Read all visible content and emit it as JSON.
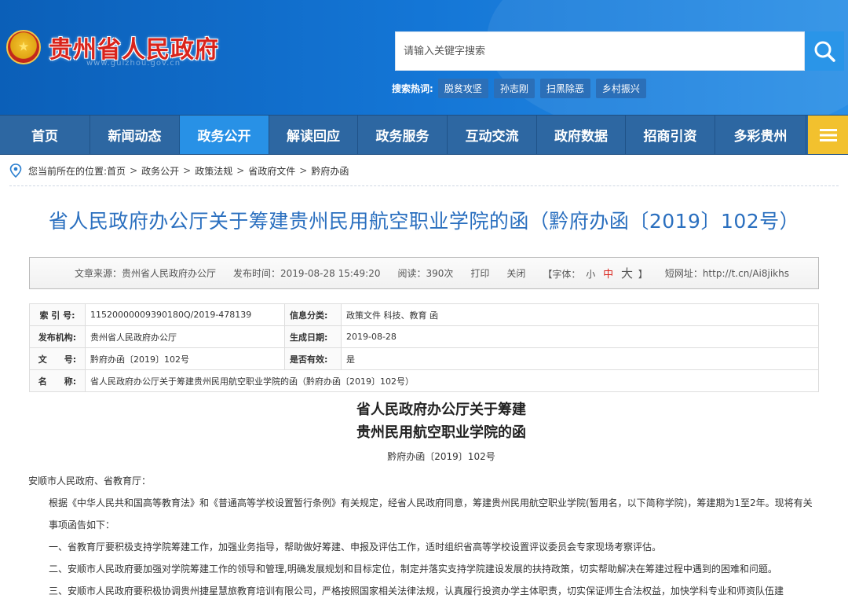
{
  "header": {
    "title": "贵州省人民政府",
    "subtitle": "www.guizhou.gov.cn",
    "search_placeholder": "请输入关键字搜索",
    "hot_label": "搜索热词:",
    "hot_tags": [
      "脱贫攻坚",
      "孙志刚",
      "扫黑除恶",
      "乡村振兴"
    ]
  },
  "nav": {
    "items": [
      "首页",
      "新闻动态",
      "政务公开",
      "解读回应",
      "政务服务",
      "互动交流",
      "政府数据",
      "招商引资",
      "多彩贵州"
    ],
    "active_index": 2
  },
  "breadcrumb": {
    "prefix": "您当前所在的位置:",
    "items": [
      "首页",
      "政务公开",
      "政策法规",
      "省政府文件",
      "黔府办函"
    ],
    "sep": ">"
  },
  "doc_title": "省人民政府办公厅关于筹建贵州民用航空职业学院的函（黔府办函〔2019〕102号）",
  "meta": {
    "source": "文章来源：贵州省人民政府办公厅",
    "time": "发布时间：2019-08-28 15:49:20",
    "views": "阅读：390次",
    "print": "打印",
    "close": "关闭",
    "font_label": "【字体：",
    "font_small": "小",
    "font_mid": "中",
    "font_big": "大",
    "font_end": "】",
    "short_url": "短网址：http://t.cn/Ai8jikhs"
  },
  "info": {
    "index_label": "索 引 号:",
    "index_value": "11520000009390180Q/2019-478139",
    "category_label": "信息分类:",
    "category_value": "政策文件   科技、教育   函",
    "org_label": "发布机构:",
    "org_value": "贵州省人民政府办公厅",
    "date_label": "生成日期:",
    "date_value": "2019-08-28",
    "docno_label": "文　　号:",
    "docno_value": "黔府办函〔2019〕102号",
    "valid_label": "是否有效:",
    "valid_value": "是",
    "name_label": "名　　称:",
    "name_value": "省人民政府办公厅关于筹建贵州民用航空职业学院的函（黔府办函〔2019〕102号）"
  },
  "article": {
    "title_line1": "省人民政府办公厅关于筹建",
    "title_line2": "贵州民用航空职业学院的函",
    "doc_no": "黔府办函〔2019〕102号",
    "salutation": "安顺市人民政府、省教育厅：",
    "para1": "根据《中华人民共和国高等教育法》和《普通高等学校设置暂行条例》有关规定，经省人民政府同意，筹建贵州民用航空职业学院(暂用名，以下简称学院)，筹建期为1至2年。现将有关事项函告如下：",
    "item1": "一、省教育厅要积极支持学院筹建工作，加强业务指导，帮助做好筹建、申报及评估工作，适时组织省高等学校设置评议委员会专家现场考察评估。",
    "item2": "二、安顺市人民政府要加强对学院筹建工作的领导和管理,明确发展规划和目标定位，制定并落实支持学院建设发展的扶持政策，切实帮助解决在筹建过程中遇到的困难和问题。",
    "item3": "三、安顺市人民政府要积极协调贵州捷星慧旅教育培训有限公司，严格按照国家相关法律法规，认真履行投资办学主体职责，切实保证师生合法权益，加快学科专业和师资队伍建"
  }
}
